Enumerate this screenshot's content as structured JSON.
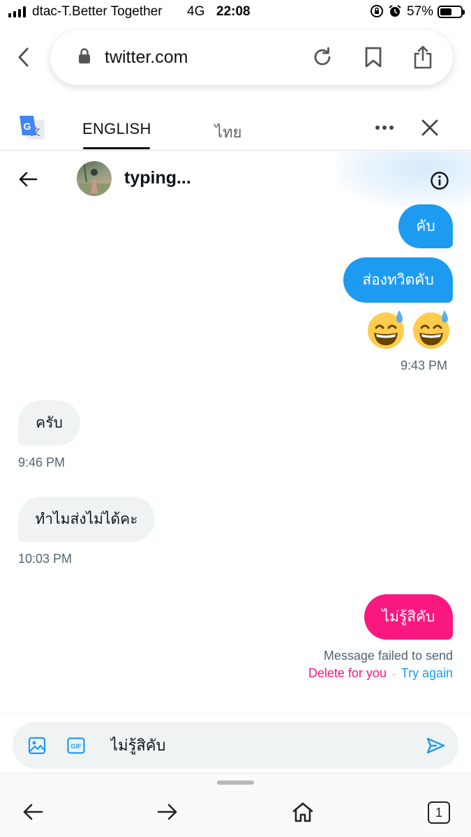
{
  "status_bar": {
    "carrier": "dtac-T.Better Together",
    "network": "4G",
    "time": "22:08",
    "battery_percent": "57%",
    "battery_level": 0.57
  },
  "browser": {
    "url": "twitter.com",
    "icons": [
      "lock-icon",
      "reload-icon",
      "bookmark-icon",
      "share-icon"
    ]
  },
  "translate_bar": {
    "tab_english": "ENGLISH",
    "tab_thai": "ไทย",
    "selected": "ENGLISH"
  },
  "conversation": {
    "name": "typing..."
  },
  "messages": [
    {
      "direction": "sent",
      "text": "คับ"
    },
    {
      "direction": "sent",
      "text": "ส่องทวิตคับ"
    },
    {
      "direction": "sent",
      "emoji": "😅😅",
      "time": "9:43 PM"
    },
    {
      "direction": "received",
      "text": "ครับ",
      "time": "9:46 PM"
    },
    {
      "direction": "received",
      "text": "ทำไมส่งไม่ได้คะ",
      "time": "10:03 PM"
    },
    {
      "direction": "sent",
      "status": "failed",
      "text": "ไม่รู้สิคับ"
    }
  ],
  "failed_notice": {
    "text": "Message failed to send",
    "delete_label": "Delete for you",
    "separator": "·",
    "retry_label": "Try again"
  },
  "composer": {
    "value": "ไม่รู้สิคับ"
  },
  "bottom_toolbar": {
    "tab_count": "1"
  },
  "colors": {
    "sent_bubble": "#1d9bf0",
    "received_bubble": "#eff3f4",
    "failed_bubble": "#f91880",
    "muted_text": "#536471"
  }
}
